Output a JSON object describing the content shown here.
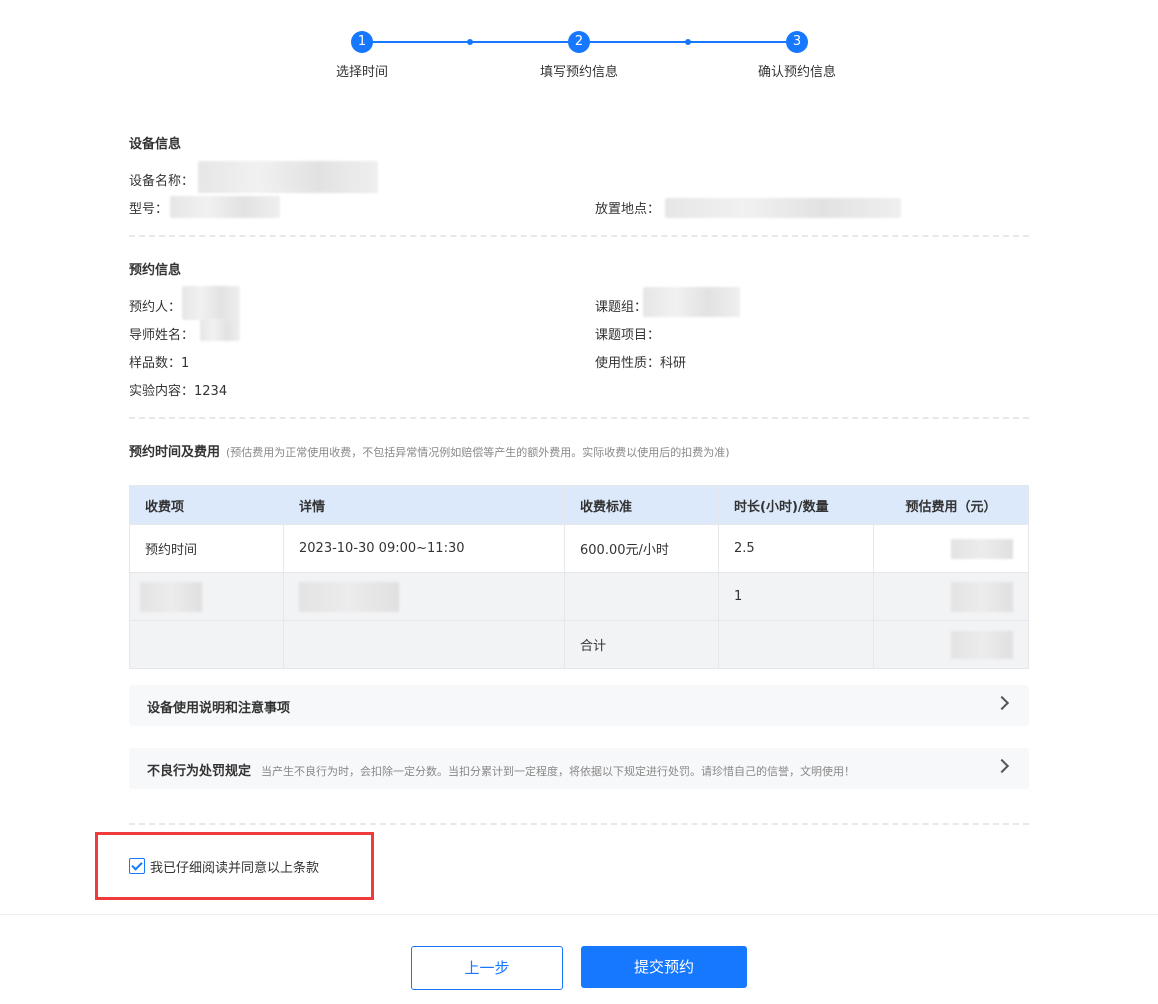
{
  "steps": [
    {
      "number": "1",
      "label": "选择时间"
    },
    {
      "number": "2",
      "label": "填写预约信息"
    },
    {
      "number": "3",
      "label": "确认预约信息"
    }
  ],
  "device_info": {
    "title": "设备信息",
    "name_label": "设备名称：",
    "model_label": "型号：",
    "location_label": "放置地点："
  },
  "booking_info": {
    "title": "预约信息",
    "booker_label": "预约人：",
    "group_label": "课题组：",
    "advisor_label": "导师姓名：",
    "project_label": "课题项目：",
    "samples": "样品数：1",
    "usage_type": "使用性质：科研",
    "content": "实验内容：1234"
  },
  "fees": {
    "title": "预约时间及费用",
    "note": "(预估费用为正常使用收费，不包括异常情况例如赔偿等产生的额外费用。实际收费以使用后的扣费为准)",
    "headers": [
      "收费项",
      "详情",
      "收费标准",
      "时长(小时)/数量",
      "预估费用（元）"
    ],
    "row1": {
      "item": "预约时间",
      "detail": "2023-10-30 09:00~11:30",
      "rate": "600.00元/小时",
      "qty": "2.5"
    },
    "row2": {
      "qty": "1"
    },
    "total_label": "合计"
  },
  "panels": {
    "instructions": "设备使用说明和注意事项",
    "penalty_title": "不良行为处罚规定",
    "penalty_desc": "当产生不良行为时，会扣除一定分数。当扣分累计到一定程度，将依据以下规定进行处罚。请珍惜自己的信誉，文明使用！"
  },
  "agreement": {
    "label": "我已仔细阅读并同意以上条款",
    "checked": true
  },
  "buttons": {
    "prev": "上一步",
    "submit": "提交预约"
  }
}
